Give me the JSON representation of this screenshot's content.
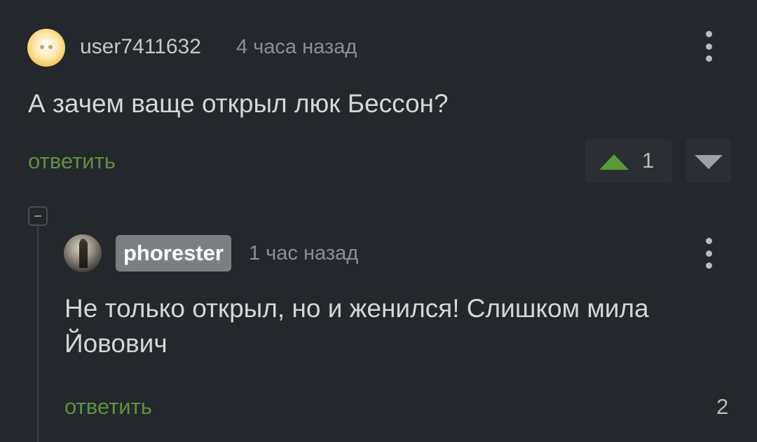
{
  "comments": [
    {
      "author": "user7411632",
      "time": "4 часа назад",
      "text": "А зачем ваще открыл люк Бессон?",
      "reply_label": "ответить",
      "rating": "1"
    },
    {
      "author": "phorester",
      "time": "1 час назад",
      "text": "Не только открыл, но и женился! Слишком мила Йовович",
      "reply_label": "ответить",
      "rating": "2"
    }
  ],
  "colors": {
    "background": "#24272b",
    "reply_link": "#609042",
    "upvote": "#5a9a3c",
    "author_badge": "#7b7f84"
  },
  "icons": {
    "menu": "more-vertical-icon",
    "upvote": "triangle-up-icon",
    "downvote": "triangle-down-icon",
    "collapse": "minus-square-icon"
  }
}
